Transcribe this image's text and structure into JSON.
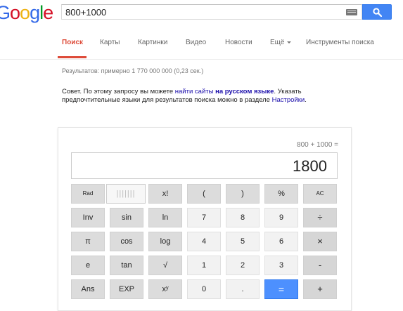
{
  "logo": [
    "G",
    "o",
    "o",
    "g",
    "l",
    "e"
  ],
  "logo_colors": [
    "#3369e8",
    "#d50f25",
    "#eeb211",
    "#3369e8",
    "#009925",
    "#d50f25"
  ],
  "search": {
    "query": "800+1000"
  },
  "tabs": [
    "Поиск",
    "Карты",
    "Картинки",
    "Видео",
    "Новости",
    "Ещё",
    "Инструменты поиска"
  ],
  "stats": "Результатов: примерно 1 770 000 000 (0,23 сек.)",
  "tip": {
    "prefix": "Совет. По этому запросу вы можете ",
    "link1": "найти сайты",
    "mid1": " ",
    "link2": "на русском языке",
    "mid2": ". Указать предпочтительные языки для результатов поиска можно в разделе ",
    "link3": "Настройки",
    "suffix": "."
  },
  "calculator": {
    "expression": "800 + 1000 =",
    "result": "1800",
    "buttons": [
      [
        "Rad",
        "|||||||",
        "x!",
        "(",
        ")",
        "%",
        "AC"
      ],
      [
        "Inv",
        "sin",
        "ln",
        "7",
        "8",
        "9",
        "÷"
      ],
      [
        "π",
        "cos",
        "log",
        "4",
        "5",
        "6",
        "×"
      ],
      [
        "e",
        "tan",
        "√",
        "1",
        "2",
        "3",
        "-"
      ],
      [
        "Ans",
        "EXP",
        "xʸ",
        "0",
        ".",
        "=",
        "+"
      ]
    ]
  },
  "colors": {
    "accent_red": "#dd4b39",
    "search_blue": "#4285f4",
    "link_blue": "#1a0dab"
  }
}
